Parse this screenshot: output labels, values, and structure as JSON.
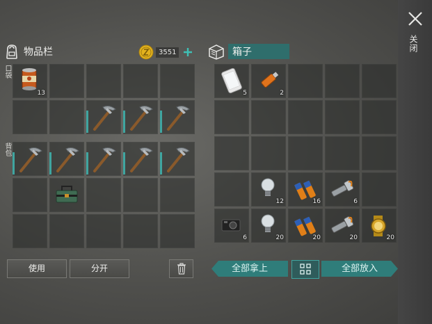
{
  "inventory": {
    "title": "物品栏",
    "coins": "3551",
    "pocket_label": "口袋",
    "backpack_label": "背包",
    "pocket_rows": [
      [
        {
          "icon": "canned-food-icon",
          "count": "13"
        },
        {},
        {},
        {},
        {}
      ],
      [
        {},
        {},
        {
          "icon": "pickaxe-icon",
          "durability": 0.8
        },
        {
          "icon": "pickaxe-icon",
          "durability": 0.8
        },
        {
          "icon": "pickaxe-icon",
          "durability": 0.8
        }
      ]
    ],
    "backpack_rows": [
      [
        {
          "icon": "pickaxe-icon",
          "durability": 0.8
        },
        {
          "icon": "pickaxe-icon",
          "durability": 0.8
        },
        {
          "icon": "pickaxe-icon",
          "durability": 0.8
        },
        {
          "icon": "pickaxe-icon",
          "durability": 0.8
        },
        {
          "icon": "pickaxe-icon",
          "durability": 0.8
        }
      ],
      [
        {},
        {
          "icon": "toolbox-icon"
        },
        {},
        {},
        {}
      ],
      [
        {},
        {},
        {},
        {},
        {}
      ]
    ]
  },
  "box": {
    "title": "箱子",
    "rows": [
      [
        {
          "icon": "phone-icon",
          "count": "5"
        },
        {
          "icon": "usb-drive-icon",
          "count": "2"
        },
        {},
        {},
        {}
      ],
      [
        {},
        {},
        {},
        {},
        {}
      ],
      [
        {},
        {},
        {},
        {},
        {}
      ],
      [
        {},
        {
          "icon": "light-bulb-icon",
          "count": "12"
        },
        {
          "icon": "battery-icon",
          "count": "16"
        },
        {
          "icon": "flashlight-icon",
          "count": "6"
        },
        {}
      ],
      [
        {
          "icon": "camera-icon",
          "count": "6"
        },
        {
          "icon": "light-bulb-icon",
          "count": "20"
        },
        {
          "icon": "battery-icon",
          "count": "20"
        },
        {
          "icon": "flashlight-icon",
          "count": "20"
        },
        {
          "icon": "watch-icon",
          "count": "20"
        }
      ]
    ]
  },
  "buttons": {
    "use": "使用",
    "split": "分开",
    "take_all": "全部拿上",
    "put_all": "全部放入"
  },
  "close_label": "关闭",
  "colors": {
    "accent": "#3fa5a0",
    "coin": "#e2b21e"
  }
}
